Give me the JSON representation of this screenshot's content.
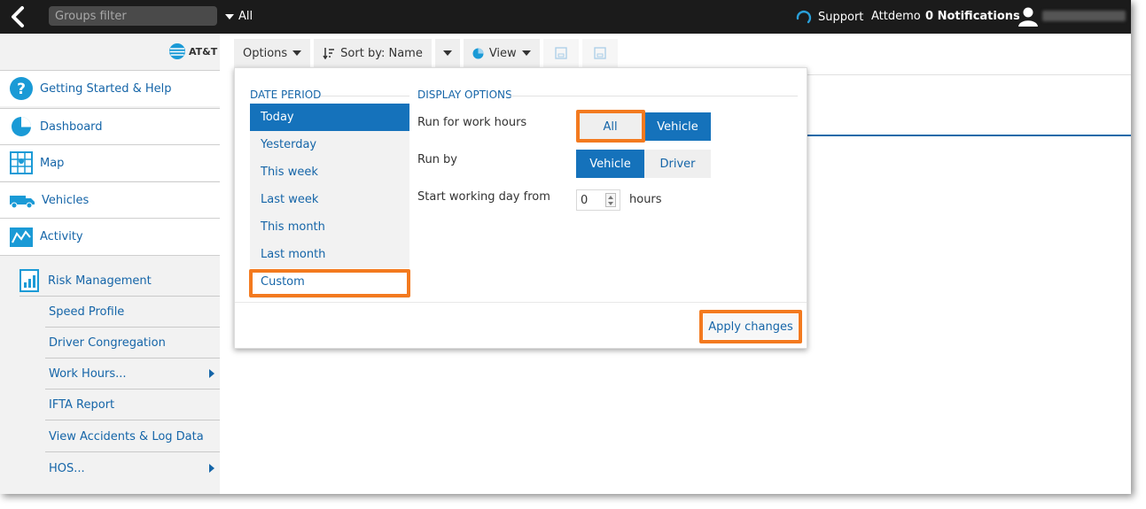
{
  "topbar": {
    "groups_filter_placeholder": "Groups filter",
    "groups_dropdown_value": "All",
    "support_label": "Support",
    "account_label": "Attdemo",
    "notifications_label": "0 Notifications"
  },
  "sidebar": {
    "brand": "AT&T",
    "items": [
      {
        "label": "Getting Started & Help",
        "icon": "help-icon"
      },
      {
        "label": "Dashboard",
        "icon": "dashboard-pie-icon"
      },
      {
        "label": "Map",
        "icon": "map-icon"
      },
      {
        "label": "Vehicles",
        "icon": "truck-icon"
      },
      {
        "label": "Activity",
        "icon": "activity-chart-icon"
      }
    ],
    "section": {
      "label": "Risk Management",
      "icon": "report-chart-icon"
    },
    "sub_items": [
      {
        "label": "Speed Profile",
        "has_submenu": false
      },
      {
        "label": "Driver Congregation",
        "has_submenu": false
      },
      {
        "label": "Work Hours...",
        "has_submenu": true
      },
      {
        "label": "IFTA Report",
        "has_submenu": false
      },
      {
        "label": "View Accidents & Log Data",
        "has_submenu": false
      },
      {
        "label": "HOS...",
        "has_submenu": true
      }
    ]
  },
  "toolbar": {
    "options_label": "Options",
    "sort_label": "Sort by: Name",
    "view_label": "View"
  },
  "date_period": {
    "title": "DATE PERIOD",
    "items": [
      "Today",
      "Yesterday",
      "This week",
      "Last week",
      "This month",
      "Last month",
      "Custom"
    ],
    "selected": "Today",
    "highlighted": "Custom"
  },
  "display_options": {
    "title": "DISPLAY OPTIONS",
    "run_for_work_hours": {
      "label": "Run for work hours",
      "options": [
        "All",
        "Vehicle"
      ],
      "selected": "Vehicle",
      "highlighted": "All"
    },
    "run_by": {
      "label": "Run by",
      "options": [
        "Vehicle",
        "Driver"
      ],
      "selected": "Vehicle"
    },
    "start_working_day": {
      "label": "Start working day from",
      "value": "0",
      "unit": "hours"
    }
  },
  "apply_label": "Apply changes",
  "colors": {
    "accent": "#1572bb",
    "highlight": "#f37a1f",
    "topbar": "#1b1b1b"
  }
}
